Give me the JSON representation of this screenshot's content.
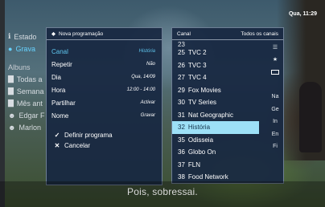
{
  "clock": "Qua, 11:29",
  "side_menu": {
    "items": [
      {
        "label": "Estado",
        "icon": "info-icon"
      },
      {
        "label": "Grava",
        "icon": "record-icon"
      }
    ],
    "section": "Albuns",
    "album_items": [
      {
        "label": "Todas a",
        "icon": "folder-icon"
      },
      {
        "label": "Semana",
        "icon": "folder-icon"
      },
      {
        "label": "Mês ant",
        "icon": "folder-icon"
      },
      {
        "label": "Edgar F",
        "icon": "person-icon"
      },
      {
        "label": "Marlon",
        "icon": "person-icon"
      }
    ]
  },
  "program_panel": {
    "title": "Nova programação",
    "fields": [
      {
        "label": "Canal",
        "value": "História"
      },
      {
        "label": "Repetir",
        "value": "Não"
      },
      {
        "label": "Dia",
        "value": "Qua, 14/09"
      },
      {
        "label": "Hora",
        "value": "12:00 - 14:00"
      },
      {
        "label": "Partilhar",
        "value": "Activar"
      },
      {
        "label": "Nome",
        "value": "Gravar"
      }
    ],
    "actions": [
      {
        "label": "Definir programa",
        "icon": "check-icon"
      },
      {
        "label": "Cancelar",
        "icon": "x-icon"
      }
    ]
  },
  "channel_panel": {
    "title": "Canal",
    "filter": "Todos os canais",
    "top_partial": "23",
    "channels": [
      {
        "num": "25",
        "name": "TVC 2"
      },
      {
        "num": "26",
        "name": "TVC 3"
      },
      {
        "num": "27",
        "name": "TVC 4"
      },
      {
        "num": "29",
        "name": "Fox Movies"
      },
      {
        "num": "30",
        "name": "TV Series"
      },
      {
        "num": "31",
        "name": "Nat Geographic"
      },
      {
        "num": "32",
        "name": "História"
      },
      {
        "num": "35",
        "name": "Odisseia"
      },
      {
        "num": "36",
        "name": "Globo On"
      },
      {
        "num": "37",
        "name": "FLN"
      },
      {
        "num": "38",
        "name": "Food Network"
      }
    ],
    "right_column": [
      "list-icon",
      "star-icon",
      "rect-icon",
      "",
      "Na",
      "Ge",
      "In",
      "En",
      "Fi"
    ]
  },
  "subtitle": "Pois, sobressai."
}
